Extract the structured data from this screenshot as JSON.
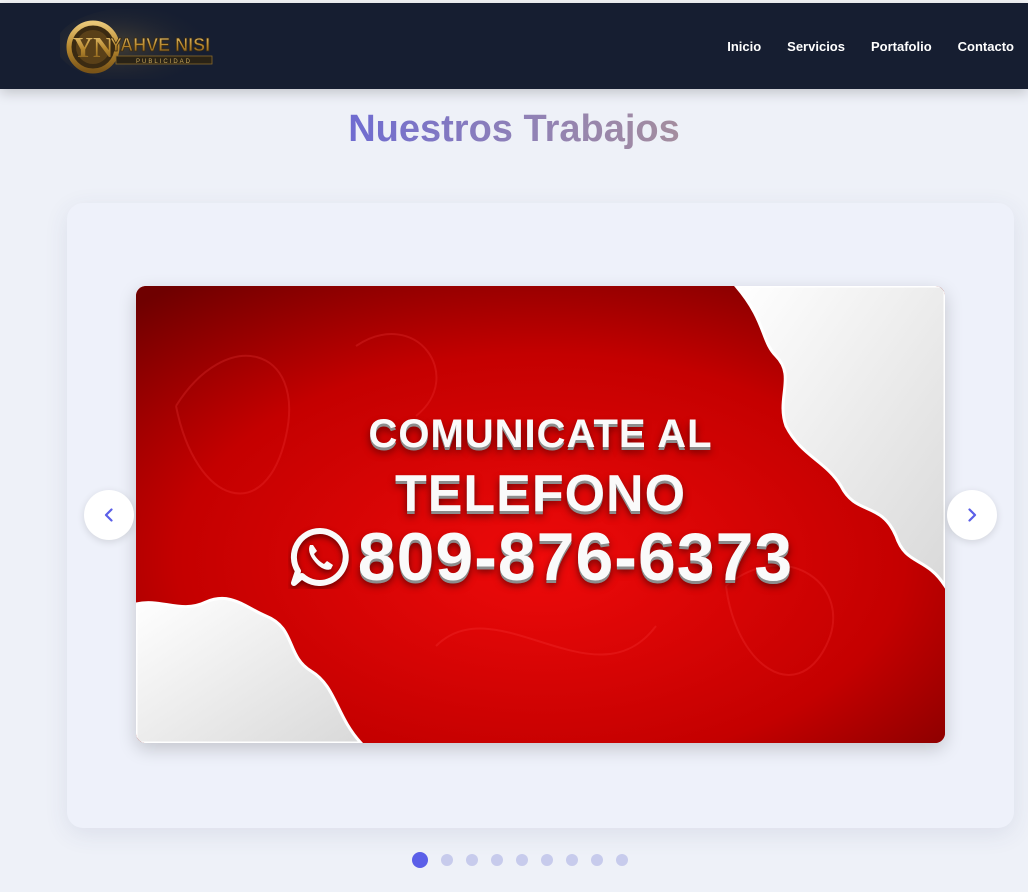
{
  "brand": {
    "logo_text": "YAHVE NISI",
    "logo_subtext": "PUBLICIDAD",
    "logo_icon": "yn-emblem-icon"
  },
  "nav": {
    "items": [
      {
        "label": "Inicio"
      },
      {
        "label": "Servicios"
      },
      {
        "label": "Portafolio"
      },
      {
        "label": "Contacto"
      }
    ]
  },
  "section": {
    "title": "Nuestros Trabajos"
  },
  "carousel": {
    "slide": {
      "line1": "COMUNICATE AL",
      "line2": "TELEFONO",
      "phone": "809-876-6373",
      "icon": "whatsapp-icon"
    },
    "prev_icon": "chevron-left-icon",
    "next_icon": "chevron-right-icon",
    "dot_count": 9,
    "active_index": 0
  },
  "colors": {
    "navbar": "#161e31",
    "accent": "#5b5fe8",
    "title_gradient": [
      "#6f6cd1",
      "#a48d9e"
    ],
    "slide_red": "#c90000",
    "page_bg": "#eef1f8"
  }
}
